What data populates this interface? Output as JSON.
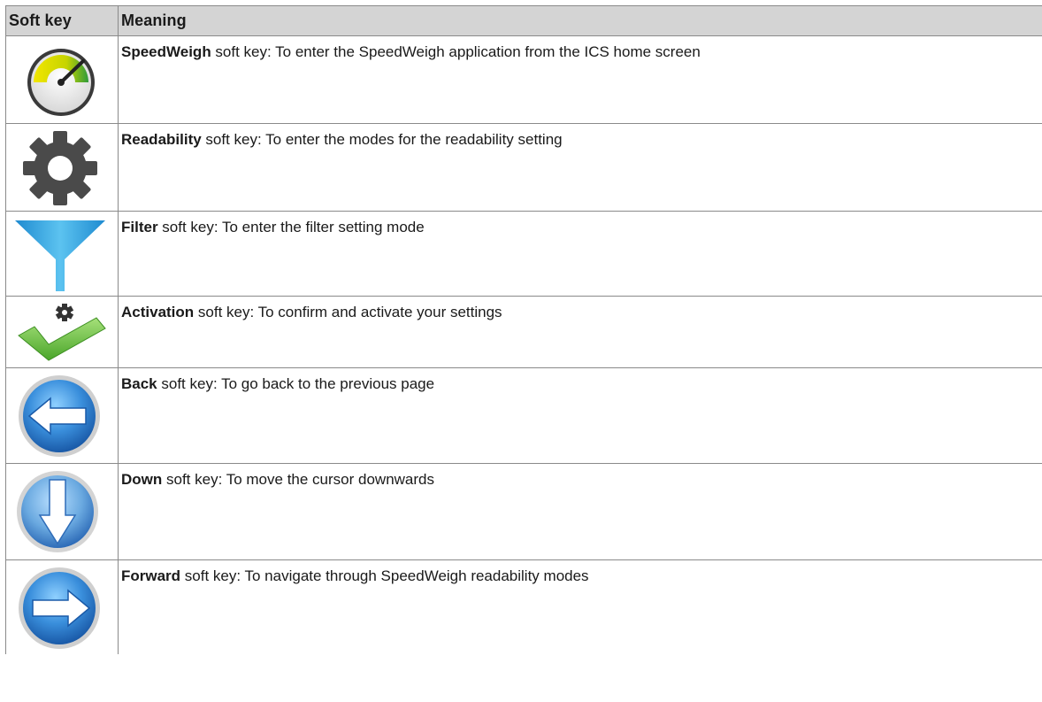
{
  "table": {
    "headers": {
      "soft_key": "Soft key",
      "meaning": "Meaning"
    },
    "rows": [
      {
        "icon": "speedometer-icon",
        "name": "SpeedWeigh",
        "description": " soft key: To enter the SpeedWeigh application from the ICS home screen"
      },
      {
        "icon": "gear-icon",
        "name": "Readability",
        "description": " soft key: To enter the modes for the readability setting"
      },
      {
        "icon": "funnel-filter-icon",
        "name": "Filter",
        "description": " soft key: To enter the filter setting mode"
      },
      {
        "icon": "checkmark-gear-icon",
        "name": "Activation",
        "description": " soft key: To confirm and activate your settings"
      },
      {
        "icon": "arrow-left-circle-icon",
        "name": "Back",
        "description": " soft key: To go back to the previous page"
      },
      {
        "icon": "arrow-down-circle-icon",
        "name": "Down",
        "description": " soft key: To move the cursor downwards"
      },
      {
        "icon": "arrow-right-circle-icon",
        "name": "Forward",
        "description": " soft key: To navigate through SpeedWeigh readability modes"
      }
    ]
  },
  "colors": {
    "header_bg": "#d4d4d4",
    "border": "#8a8a8a",
    "gear": "#4a4a4a",
    "filter_blue": "#2aa3dc",
    "check_green": "#6cbf3a",
    "circle_blue": "#3a7fc8"
  }
}
